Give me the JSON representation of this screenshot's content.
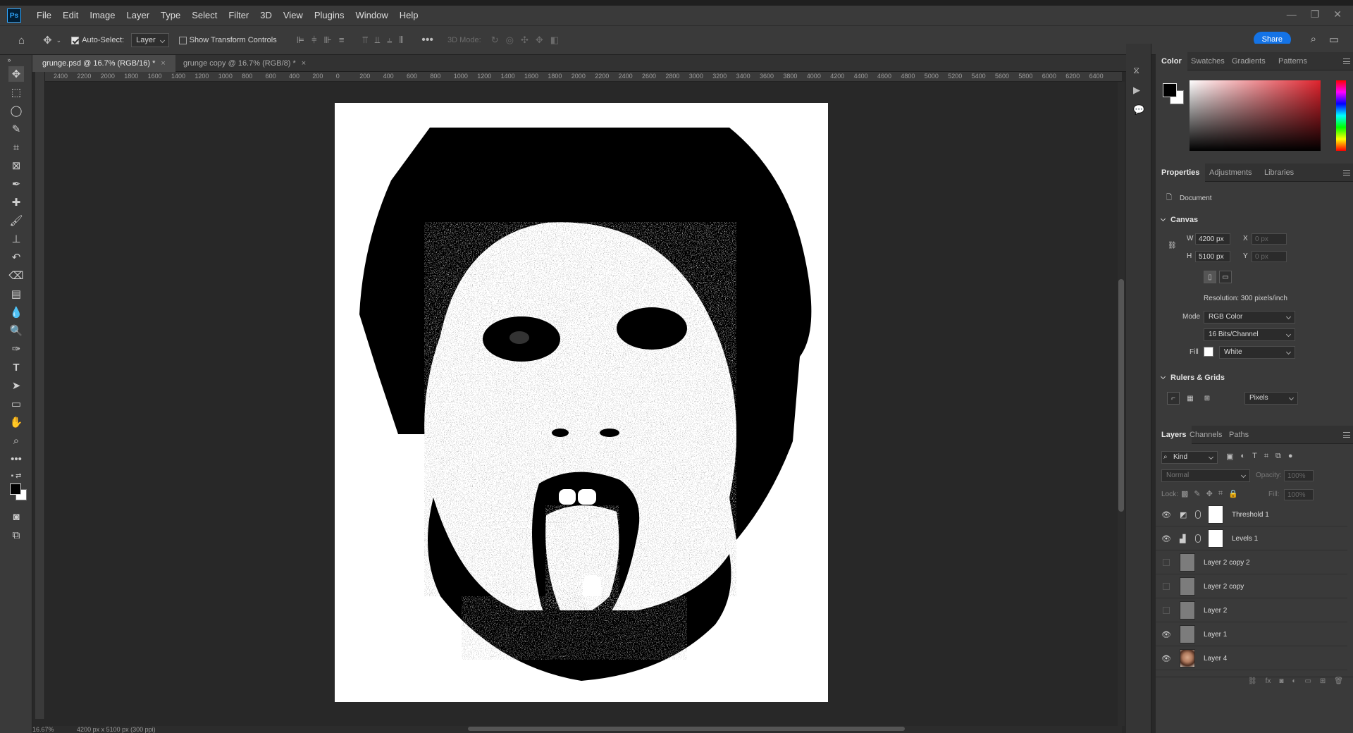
{
  "app": {
    "logo": "Ps"
  },
  "menu": [
    "File",
    "Edit",
    "Image",
    "Layer",
    "Type",
    "Select",
    "Filter",
    "3D",
    "View",
    "Plugins",
    "Window",
    "Help"
  ],
  "options": {
    "auto_select_label": "Auto-Select:",
    "auto_select_target": "Layer",
    "show_transform_label": "Show Transform Controls",
    "three_d_mode_label": "3D Mode:",
    "share_label": "Share"
  },
  "tabs": [
    {
      "label": "grunge.psd @ 16.7% (RGB/16) *",
      "close": "×"
    },
    {
      "label": "grunge copy @ 16.7% (RGB/8) *",
      "close": "×"
    }
  ],
  "ruler": {
    "horizontal": [
      "2400",
      "2200",
      "2000",
      "1800",
      "1600",
      "1400",
      "1200",
      "1000",
      "800",
      "600",
      "400",
      "200",
      "0",
      "200",
      "400",
      "600",
      "800",
      "1000",
      "1200",
      "1400",
      "1600",
      "1800",
      "2000",
      "2200",
      "2400",
      "2600",
      "2800",
      "3000",
      "3200",
      "3400",
      "3600",
      "3800",
      "4000",
      "4200",
      "4400",
      "4600",
      "4800",
      "5000",
      "5200",
      "5400",
      "5600",
      "5800",
      "6000",
      "6200",
      "6400"
    ]
  },
  "status": {
    "zoom": "16.67%",
    "doc_size": "4200 px x 5100 px (300 ppi)"
  },
  "color_panel": {
    "tabs": [
      "Color",
      "Swatches",
      "Gradients",
      "Patterns"
    ],
    "foreground": "#000000",
    "background": "#ffffff"
  },
  "properties_panel": {
    "tabs": [
      "Properties",
      "Adjustments",
      "Libraries"
    ],
    "kind": "Document",
    "canvas_title": "Canvas",
    "w_label": "W",
    "w_value": "4200 px",
    "h_label": "H",
    "h_value": "5100 px",
    "x_label": "X",
    "x_value": "0 px",
    "y_label": "Y",
    "y_value": "0 px",
    "resolution": "Resolution: 300 pixels/inch",
    "mode_label": "Mode",
    "mode_value": "RGB Color",
    "depth_value": "16 Bits/Channel",
    "fill_label": "Fill",
    "fill_value": "White",
    "rulers_title": "Rulers & Grids",
    "units_value": "Pixels"
  },
  "layers_panel": {
    "tabs": [
      "Layers",
      "Channels",
      "Paths"
    ],
    "filter_kind": "Kind",
    "blend_mode": "Normal",
    "opacity_label": "Opacity:",
    "opacity_value": "100%",
    "lock_label": "Lock:",
    "fill_label": "Fill:",
    "fill_value": "100%",
    "layers": [
      {
        "name": "Threshold 1",
        "visible": true,
        "type": "adjustment",
        "icon": "threshold-icon"
      },
      {
        "name": "Levels 1",
        "visible": true,
        "type": "adjustment",
        "icon": "levels-icon"
      },
      {
        "name": "Layer 2 copy 2",
        "visible": false,
        "type": "pixel"
      },
      {
        "name": "Layer 2 copy",
        "visible": false,
        "type": "pixel"
      },
      {
        "name": "Layer 2",
        "visible": false,
        "type": "pixel"
      },
      {
        "name": "Layer 1",
        "visible": true,
        "type": "pixel"
      },
      {
        "name": "Layer 4",
        "visible": true,
        "type": "photo"
      }
    ]
  }
}
